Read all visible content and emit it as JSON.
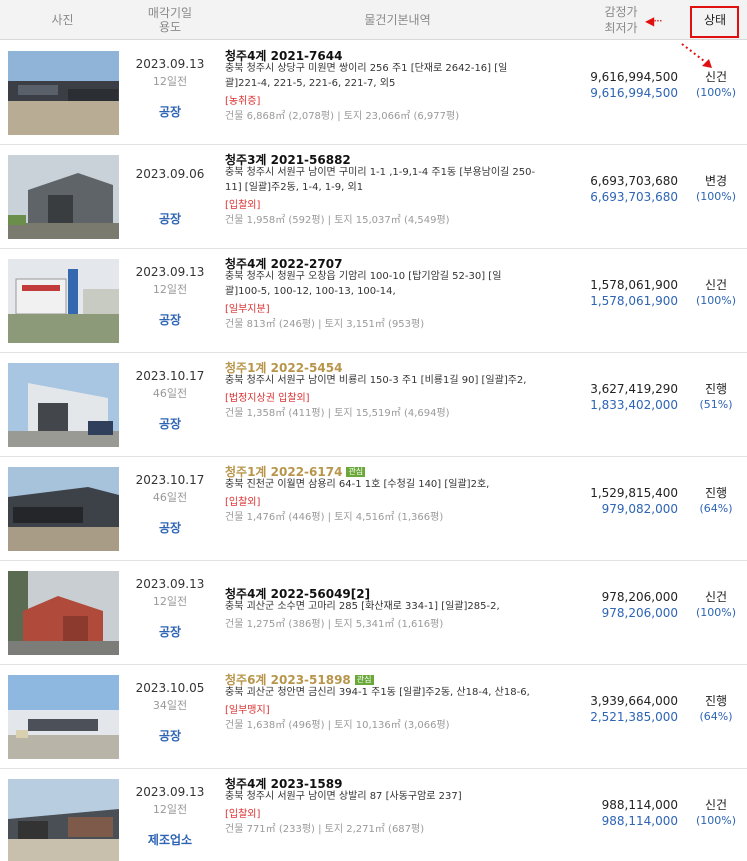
{
  "header": {
    "photo": "사진",
    "date_line1": "매각기일",
    "date_line2": "용도",
    "info": "물건기본내역",
    "price_line1": "감정가",
    "price_line2": "최저가",
    "status": "상태",
    "arrow": "◀···"
  },
  "rows": [
    {
      "date": "2023.09.13",
      "ago": "12일전",
      "kind": "공장",
      "case": "청주4계 2021-7644",
      "case_gold": false,
      "badge": "",
      "addr_l1": "충북 청주시 상당구 미원면 쌍이리 256 주1 [단재로 2642-16] [일",
      "addr_l2": "괄]221-4, 221-5, 221-6, 221-7, 외5",
      "tag": "[농취증]",
      "area": "건물 6,868㎡ (2,078평)  |  토지 23,066㎡ (6,977평)",
      "appraisal": "9,616,994,500",
      "minimum": "9,616,994,500",
      "status": "신건",
      "pct": "(100%)"
    },
    {
      "date": "2023.09.06",
      "ago": "",
      "kind": "공장",
      "case": "청주3계 2021-56882",
      "case_gold": false,
      "badge": "",
      "addr_l1": "충북 청주시 서원구 남이면 구미리 1-1 ,1-9,1-4 주1동 [부용남이길 250-",
      "addr_l2": "11] [일괄]주2동, 1-4, 1-9, 외1",
      "tag": "[입찰외]",
      "area": "건물 1,958㎡ (592평)  |  토지 15,037㎡ (4,549평)",
      "appraisal": "6,693,703,680",
      "minimum": "6,693,703,680",
      "status": "변경",
      "pct": "(100%)"
    },
    {
      "date": "2023.09.13",
      "ago": "12일전",
      "kind": "공장",
      "case": "청주4계 2022-2707",
      "case_gold": false,
      "badge": "",
      "addr_l1": "충북 청주시 청원구 오창읍 기암리 100-10 [탑기암길 52-30] [일",
      "addr_l2": "괄]100-5, 100-12, 100-13, 100-14,",
      "tag": "[일부지분]",
      "area": "건물 813㎡ (246평)  |  토지 3,151㎡ (953평)",
      "appraisal": "1,578,061,900",
      "minimum": "1,578,061,900",
      "status": "신건",
      "pct": "(100%)"
    },
    {
      "date": "2023.10.17",
      "ago": "46일전",
      "kind": "공장",
      "case": "청주1계 2022-5454",
      "case_gold": true,
      "badge": "",
      "addr_l1": "충북 청주시 서원구 남이면 비룡리 150-3 주1 [비룡1길 90] [일괄]주2,",
      "addr_l2": "",
      "tag": "[법정지상권  입찰외]",
      "area": "건물 1,358㎡ (411평)  |  토지 15,519㎡ (4,694평)",
      "appraisal": "3,627,419,290",
      "minimum": "1,833,402,000",
      "status": "진행",
      "pct": "(51%)"
    },
    {
      "date": "2023.10.17",
      "ago": "46일전",
      "kind": "공장",
      "case": "청주1계 2022-6174",
      "case_gold": true,
      "badge": "관심",
      "addr_l1": "충북 진천군 이월면 삼용리 64-1 1호 [수청길 140] [일괄]2호,",
      "addr_l2": "",
      "tag": "[입찰외]",
      "area": "건물 1,476㎡ (446평)  |  토지 4,516㎡ (1,366평)",
      "appraisal": "1,529,815,400",
      "minimum": "979,082,000",
      "status": "진행",
      "pct": "(64%)"
    },
    {
      "date": "2023.09.13",
      "ago": "12일전",
      "kind": "공장",
      "case": "청주4계 2022-56049[2]",
      "case_gold": false,
      "badge": "",
      "addr_l1": "충북 괴산군 소수면 고마리 285 [화산재로 334-1] [일괄]285-2,",
      "addr_l2": "",
      "tag": "",
      "area": "건물 1,275㎡ (386평)  |  토지 5,341㎡ (1,616평)",
      "appraisal": "978,206,000",
      "minimum": "978,206,000",
      "status": "신건",
      "pct": "(100%)"
    },
    {
      "date": "2023.10.05",
      "ago": "34일전",
      "kind": "공장",
      "case": "청주6계 2023-51898",
      "case_gold": true,
      "badge": "관심",
      "addr_l1": "충북 괴산군 청안면 금신리 394-1 주1동 [일괄]주2동, 산18-4, 산18-6,",
      "addr_l2": "",
      "tag": "[일부맹지]",
      "area": "건물 1,638㎡ (496평)  |  토지 10,136㎡ (3,066평)",
      "appraisal": "3,939,664,000",
      "minimum": "2,521,385,000",
      "status": "진행",
      "pct": "(64%)"
    },
    {
      "date": "2023.09.13",
      "ago": "12일전",
      "kind": "제조업소",
      "case": "청주4계 2023-1589",
      "case_gold": false,
      "badge": "",
      "addr_l1": "충북 청주시 서원구 남이면 상발리 87 [사동구암로 237]",
      "addr_l2": "",
      "tag": "[입찰외]",
      "area": "건물 771㎡ (233평)  |  토지 2,271㎡ (687평)",
      "appraisal": "988,114,000",
      "minimum": "988,114,000",
      "status": "신건",
      "pct": "(100%)"
    }
  ]
}
